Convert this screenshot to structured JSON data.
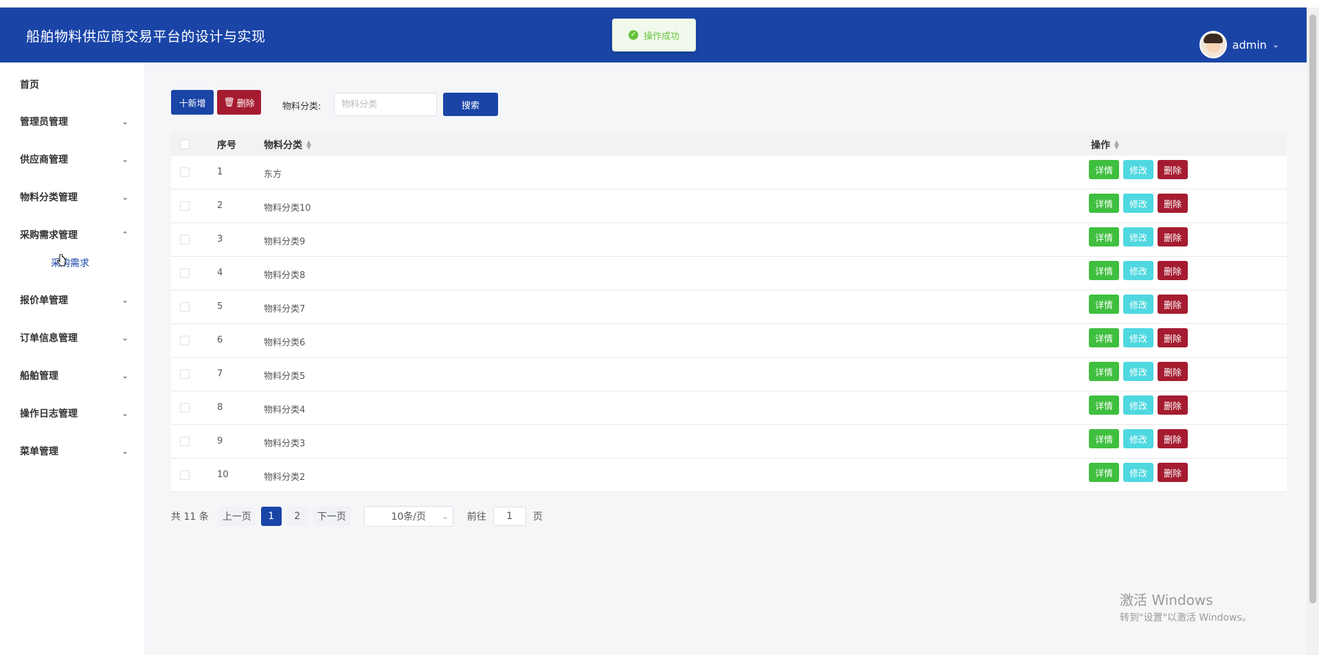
{
  "header": {
    "title": "船舶物料供应商交易平台的设计与实现",
    "username": "admin"
  },
  "toast": {
    "text": "操作成功"
  },
  "sidebar": {
    "items": [
      {
        "label": "首页",
        "chevron": ""
      },
      {
        "label": "管理员管理",
        "chevron": "⌄"
      },
      {
        "label": "供应商管理",
        "chevron": "⌄"
      },
      {
        "label": "物料分类管理",
        "chevron": "⌄"
      },
      {
        "label": "采购需求管理",
        "chevron": "⌃"
      },
      {
        "label": "报价单管理",
        "chevron": "⌄"
      },
      {
        "label": "订单信息管理",
        "chevron": "⌄"
      },
      {
        "label": "船舶管理",
        "chevron": "⌄"
      },
      {
        "label": "操作日志管理",
        "chevron": "⌄"
      },
      {
        "label": "菜单管理",
        "chevron": "⌄"
      }
    ],
    "subitem": "采购需求"
  },
  "toolbar": {
    "add_label": "十新增",
    "delete_label": "删除",
    "filter_label": "物料分类:",
    "filter_placeholder": "物料分类",
    "search_label": "搜索"
  },
  "table": {
    "headers": {
      "index": "序号",
      "category": "物料分类",
      "ops": "操作"
    },
    "rows": [
      {
        "index": "1",
        "category": "东方"
      },
      {
        "index": "2",
        "category": "物料分类10"
      },
      {
        "index": "3",
        "category": "物料分类9"
      },
      {
        "index": "4",
        "category": "物料分类8"
      },
      {
        "index": "5",
        "category": "物料分类7"
      },
      {
        "index": "6",
        "category": "物料分类6"
      },
      {
        "index": "7",
        "category": "物料分类5"
      },
      {
        "index": "8",
        "category": "物料分类4"
      },
      {
        "index": "9",
        "category": "物料分类3"
      },
      {
        "index": "10",
        "category": "物料分类2"
      }
    ],
    "op_labels": {
      "detail": "详情",
      "edit": "修改",
      "delete": "删除"
    }
  },
  "pagination": {
    "total": "共 11 条",
    "prev": "上一页",
    "pages": [
      "1",
      "2"
    ],
    "current": "1",
    "next": "下一页",
    "page_size": "10条/页",
    "goto_label": "前往",
    "goto_value": "1",
    "goto_suffix": "页"
  },
  "watermark": {
    "line1": "激活 Windows",
    "line2": "转到\"设置\"以激活 Windows。"
  },
  "colors": {
    "header": "#1a45a7",
    "primary": "#1a45a7",
    "danger": "#a51c30",
    "success": "#3fbf3f",
    "info": "#4fd8e0"
  }
}
